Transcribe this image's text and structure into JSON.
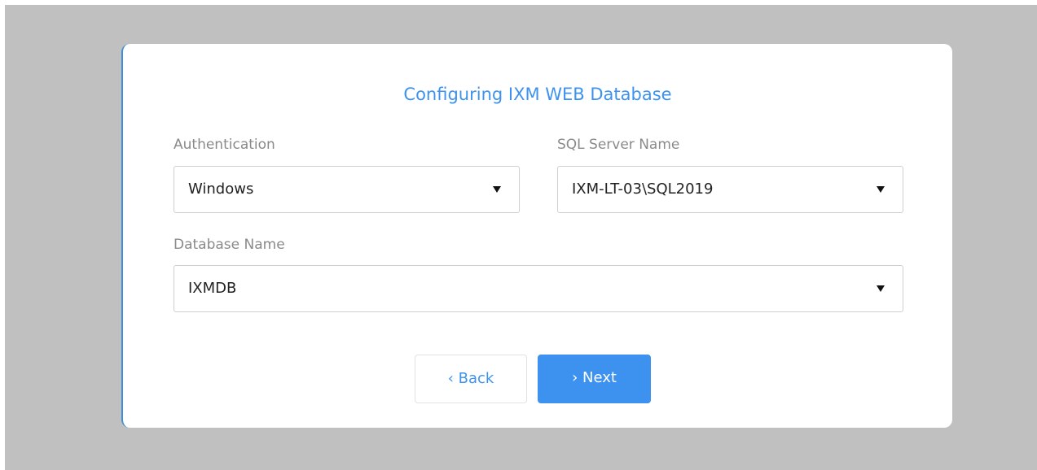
{
  "dialog": {
    "title": "Configuring IXM WEB Database"
  },
  "fields": {
    "authentication": {
      "label": "Authentication",
      "value": "Windows"
    },
    "sql_server_name": {
      "label": "SQL Server Name",
      "value": "IXM-LT-03\\SQL2019"
    },
    "database_name": {
      "label": "Database Name",
      "value": "IXMDB"
    }
  },
  "buttons": {
    "back_label": "‹ Back",
    "next_label": "› Next"
  },
  "colors": {
    "accent": "#3d92f0",
    "backdrop": "#c0c0c0",
    "label": "#8a8a8a"
  }
}
